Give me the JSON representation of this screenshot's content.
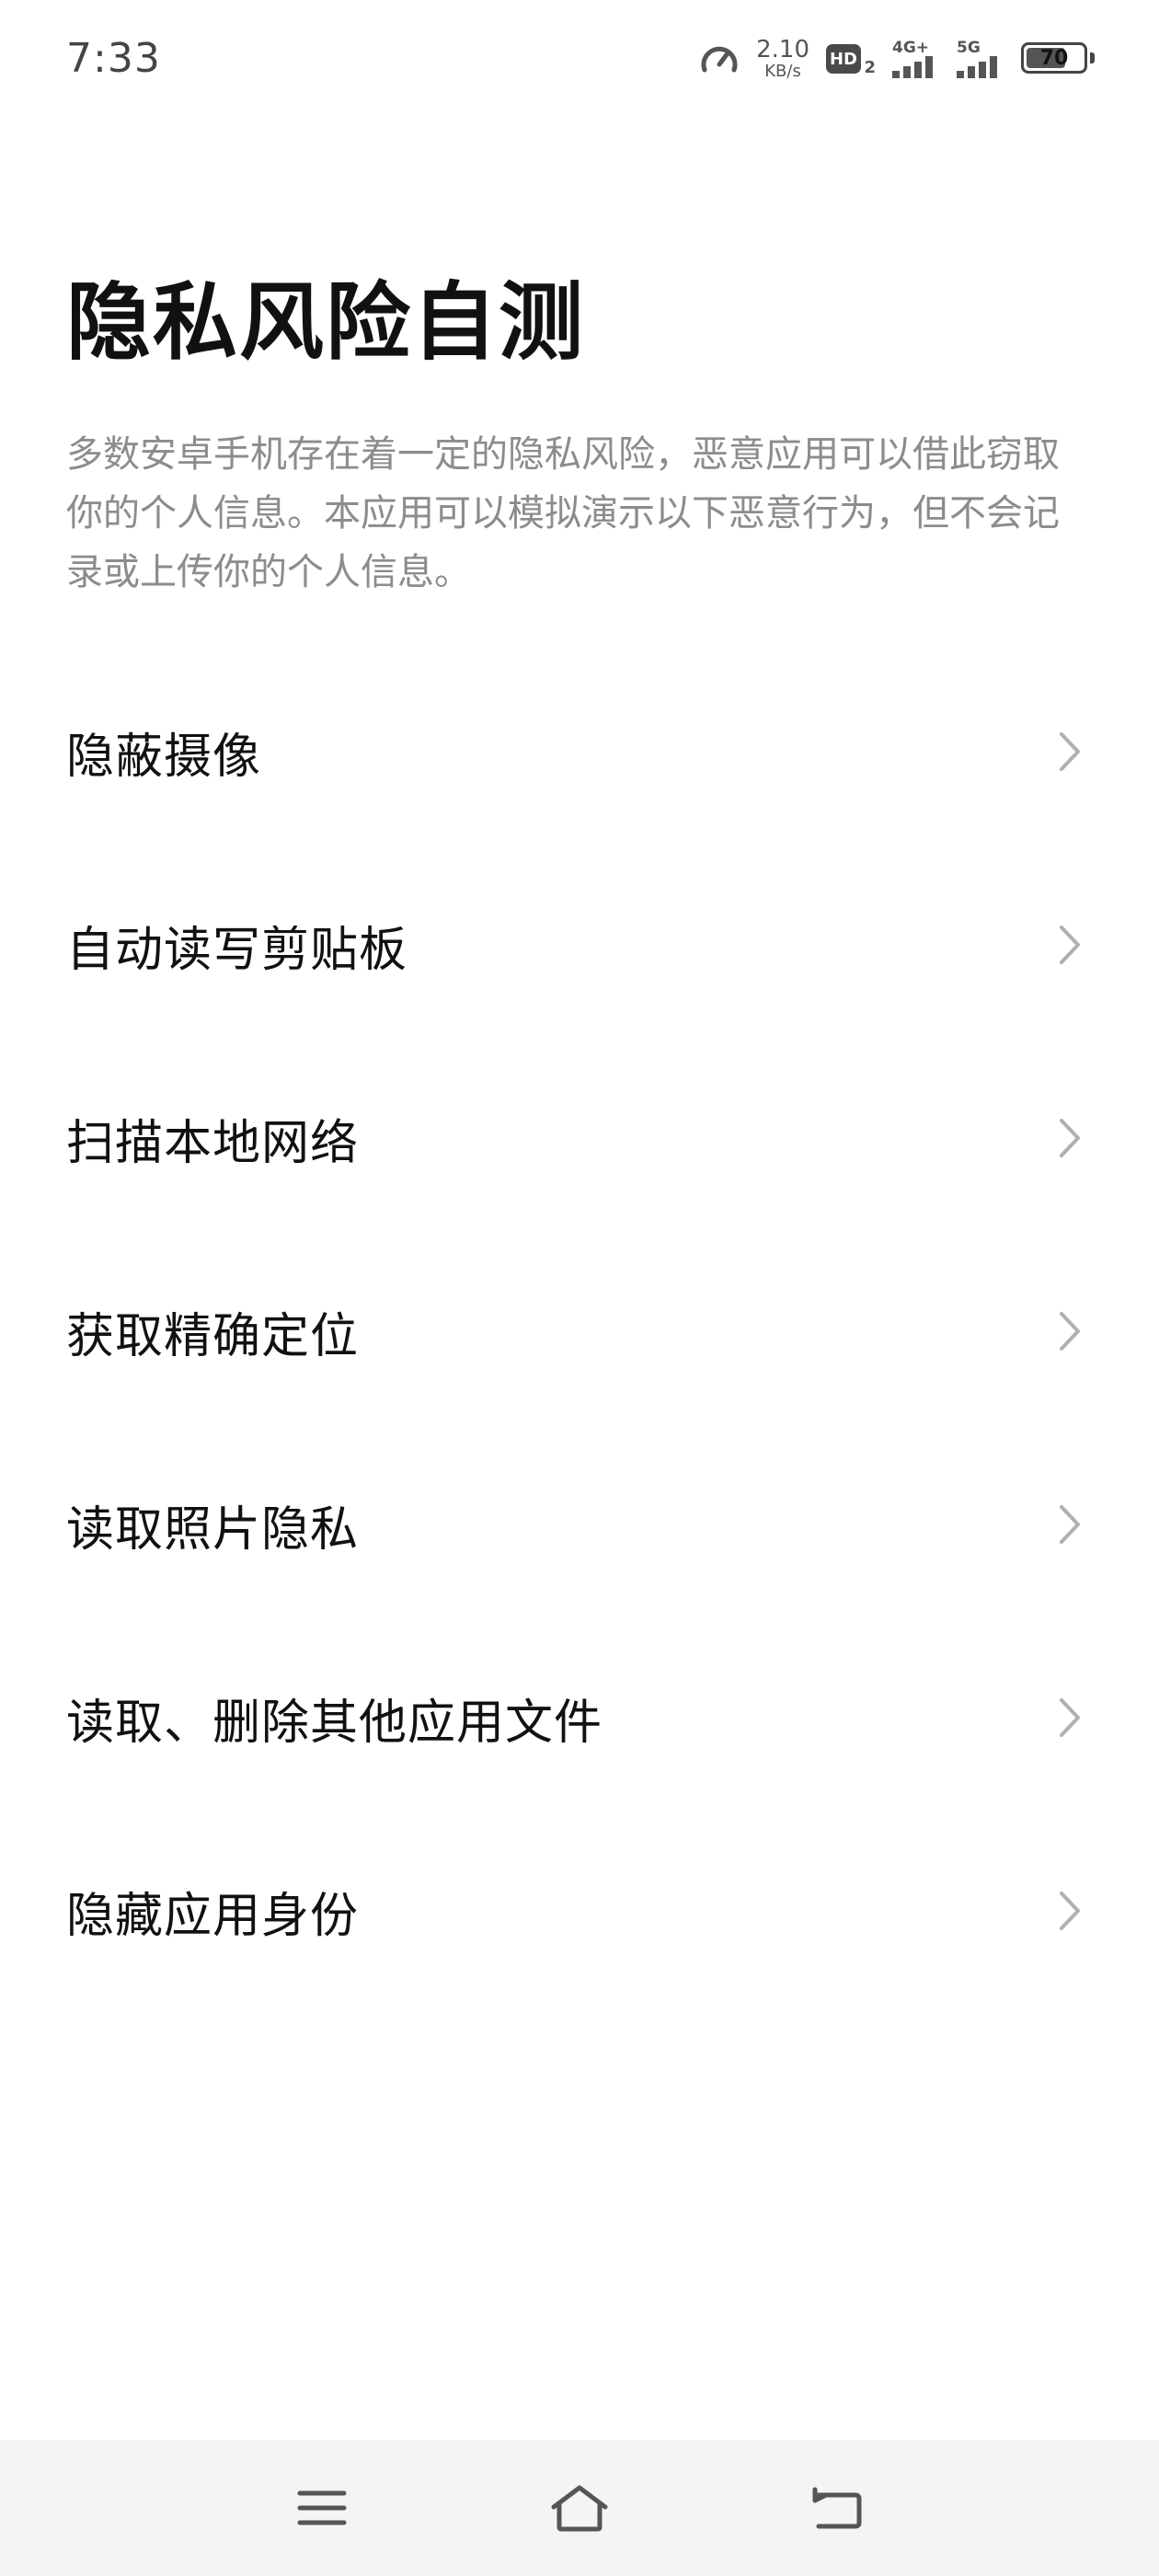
{
  "status_bar": {
    "time": "7:33",
    "net_speed_value": "2.10",
    "net_speed_unit": "KB/s",
    "hd_label": "HD",
    "hd_sub": "2",
    "signal_1_tag": "4G+",
    "signal_2_tag": "5G",
    "battery_level": "70",
    "battery_fraction": 0.7
  },
  "header": {
    "title": "隐私风险自测",
    "description": "多数安卓手机存在着一定的隐私风险，恶意应用可以借此窃取你的个人信息。本应用可以模拟演示以下恶意行为，但不会记录或上传你的个人信息。"
  },
  "menu": {
    "items": [
      {
        "label": "隐蔽摄像",
        "icon": "chevron-right-icon"
      },
      {
        "label": "自动读写剪贴板",
        "icon": "chevron-right-icon"
      },
      {
        "label": "扫描本地网络",
        "icon": "chevron-right-icon"
      },
      {
        "label": "获取精确定位",
        "icon": "chevron-right-icon"
      },
      {
        "label": "读取照片隐私",
        "icon": "chevron-right-icon"
      },
      {
        "label": "读取、删除其他应用文件",
        "icon": "chevron-right-icon"
      },
      {
        "label": "隐藏应用身份",
        "icon": "chevron-right-icon"
      }
    ]
  },
  "nav_bar": {
    "buttons": [
      "menu-icon",
      "home-icon",
      "back-icon"
    ]
  },
  "colors": {
    "title": "#111111",
    "description": "#8c8c8c",
    "chevron": "#b0b0b0",
    "nav_bar_bg": "#f4f4f4",
    "nav_icon": "#555555"
  }
}
